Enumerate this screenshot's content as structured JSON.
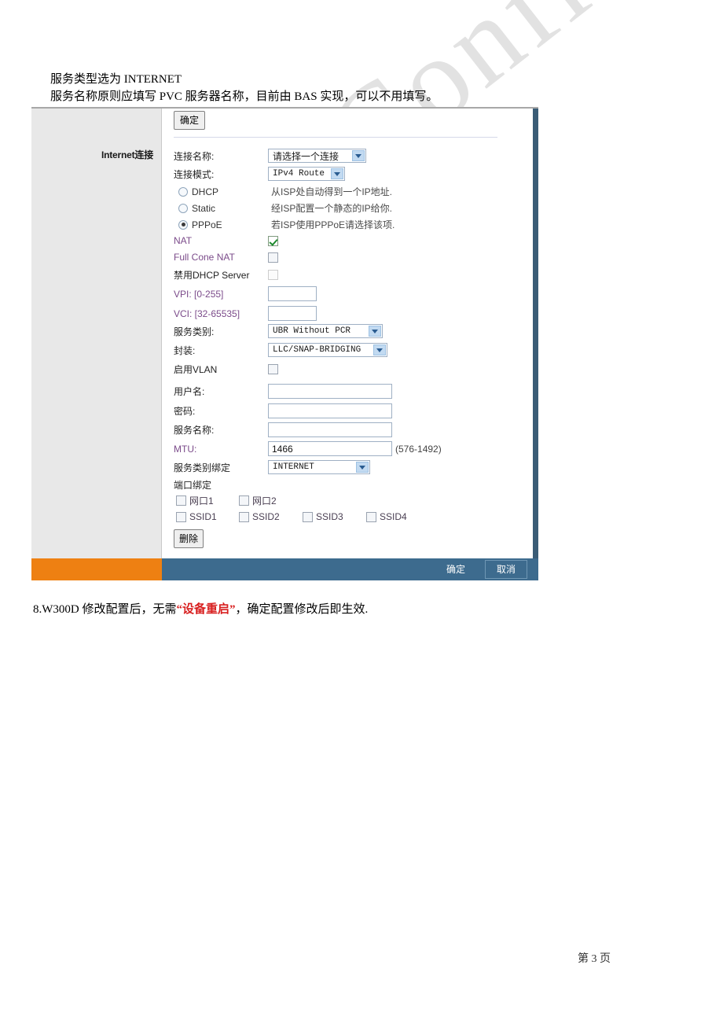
{
  "document": {
    "intro_line_1": "服务类型选为 INTERNET",
    "intro_line_2": "服务名称原则应填写 PVC 服务器名称，目前由 BAS 实现，可以不用填写。",
    "note_prefix": "8.W300D 修改配置后，无需",
    "note_highlight": "“设备重启”",
    "note_suffix": "，确定配置修改后即生效.",
    "page_number": "第 3 页",
    "watermark": "ZTE Confidential"
  },
  "router_ui": {
    "sidebar_label": "Internet连接",
    "top_ok_label": "确定",
    "fields": {
      "connection_name_label": "连接名称:",
      "connection_name_value": "请选择一个连接",
      "connection_mode_label": "连接模式:",
      "connection_mode_value": "IPv4 Route",
      "dhcp_label": "DHCP",
      "dhcp_hint": "从ISP处自动得到一个IP地址.",
      "static_label": "Static",
      "static_hint": "经ISP配置一个静态的IP给你.",
      "pppoe_label": "PPPoE",
      "pppoe_hint": "若ISP使用PPPoE请选择该项.",
      "nat_label": "NAT",
      "full_cone_nat_label": "Full Cone NAT",
      "disable_dhcp_server_label": "禁用DHCP Server",
      "vpi_label": "VPI: [0-255]",
      "vpi_value": "",
      "vci_label": "VCI: [32-65535]",
      "vci_value": "",
      "service_class_label": "服务类别:",
      "service_class_value": "UBR Without PCR",
      "encapsulation_label": "封装:",
      "encapsulation_value": "LLC/SNAP-BRIDGING",
      "enable_vlan_label": "启用VLAN",
      "username_label": "用户名:",
      "username_value": "",
      "password_label": "密码:",
      "password_value": "",
      "service_name_label": "服务名称:",
      "service_name_value": "",
      "mtu_label": "MTU:",
      "mtu_value": "1466",
      "mtu_range": "(576-1492)",
      "service_bind_label": "服务类别绑定",
      "service_bind_value": "INTERNET",
      "port_bind_label": "端口绑定",
      "delete_label": "删除"
    },
    "radio_selected": "PPPoE",
    "checkboxes": {
      "nat": true,
      "full_cone_nat": false,
      "disable_dhcp_server": false,
      "enable_vlan": false
    },
    "port_bindings": [
      {
        "label": "网口1",
        "checked": false
      },
      {
        "label": "网口2",
        "checked": false
      },
      {
        "label": "SSID1",
        "checked": false
      },
      {
        "label": "SSID2",
        "checked": false
      },
      {
        "label": "SSID3",
        "checked": false
      },
      {
        "label": "SSID4",
        "checked": false
      }
    ],
    "footer": {
      "ok_label": "确定",
      "cancel_label": "取消"
    },
    "colors": {
      "footer_orange": "#ee8012",
      "footer_blue": "#3d6b8e",
      "sidebar_gray": "#e8e8e8",
      "label_violet": "#7b4b8a",
      "scrollbar": "#3a5c76"
    }
  }
}
